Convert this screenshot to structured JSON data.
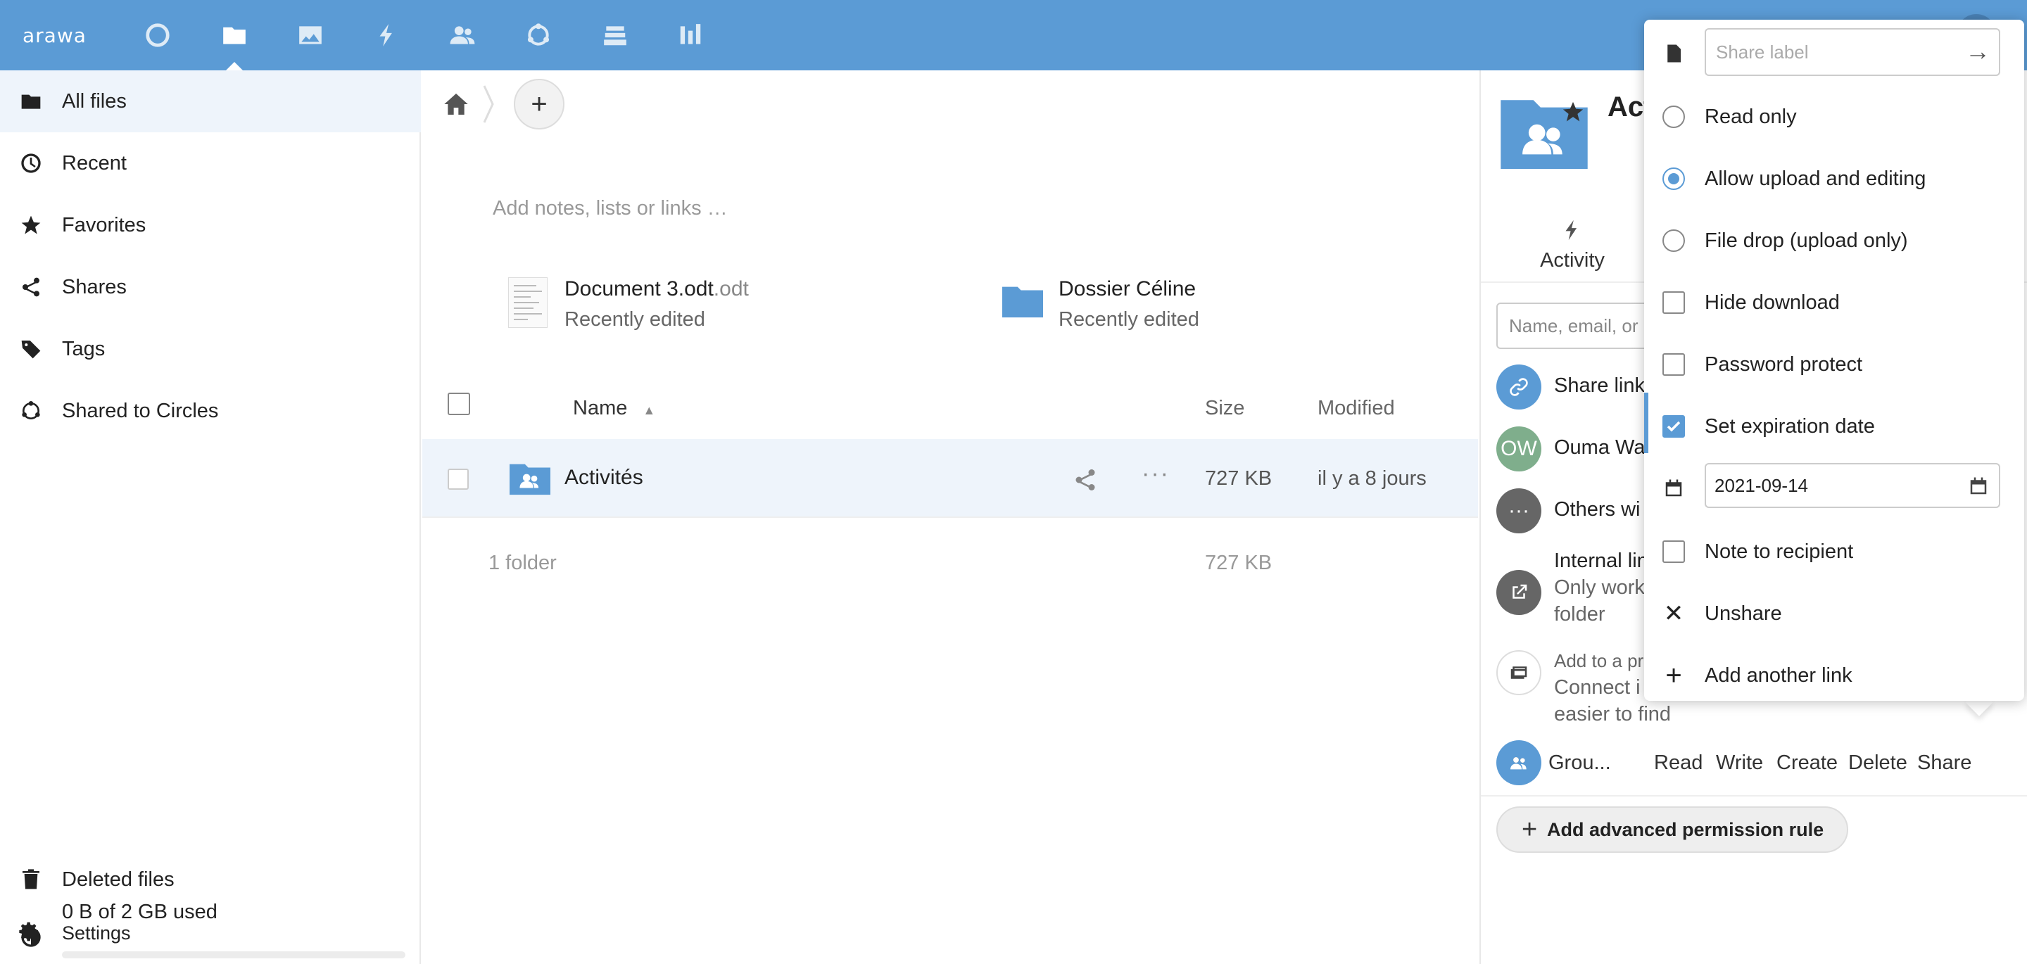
{
  "header": {
    "logo": "arawa",
    "apps": [
      "dashboard-icon",
      "files-icon",
      "photos-icon",
      "activity-icon",
      "contacts-icon",
      "circles-icon",
      "deck-icon",
      "analytics-icon"
    ]
  },
  "nav": {
    "items": [
      {
        "label": "All files",
        "icon": "folder-icon"
      },
      {
        "label": "Recent",
        "icon": "clock-icon"
      },
      {
        "label": "Favorites",
        "icon": "star-icon"
      },
      {
        "label": "Shares",
        "icon": "share-icon"
      },
      {
        "label": "Tags",
        "icon": "tag-icon"
      },
      {
        "label": "Shared to Circles",
        "icon": "circles-icon"
      }
    ],
    "deleted_label": "Deleted files",
    "quota_label": "0 B of 2 GB used",
    "settings_label": "Settings"
  },
  "main": {
    "add_label": "+",
    "notes_placeholder": "Add notes, lists or links …",
    "recent": [
      {
        "name": "Document 3.odt",
        "ext": ".odt",
        "sub": "Recently edited"
      },
      {
        "name": "Dossier Céline",
        "ext": "",
        "sub": "Recently edited"
      }
    ],
    "columns": {
      "name": "Name",
      "size": "Size",
      "modified": "Modified"
    },
    "files": [
      {
        "name": "Activités",
        "size": "727 KB",
        "modified": "il y a 8 jours"
      }
    ],
    "summary": {
      "count": "1 folder",
      "size": "727 KB"
    }
  },
  "sidebar": {
    "title": "Act",
    "tab_label": "Activity",
    "search_placeholder": "Name, email, or",
    "rows": [
      {
        "label": "Share link",
        "initials": "",
        "color": "#5b9bd5"
      },
      {
        "label": "Ouma Wa",
        "initials": "OW",
        "color": "#7fae8c"
      },
      {
        "label": "Others wi",
        "initials": "",
        "color": "#666666"
      }
    ],
    "internal": {
      "title": "Internal lin",
      "line2": "Only work",
      "line3": "folder"
    },
    "project": {
      "title": "Add to a pr",
      "line2": "Connect i",
      "line3": "easier to find"
    },
    "group_name": "Grou...",
    "perms": [
      "Read",
      "Write",
      "Create",
      "Delete",
      "Share"
    ],
    "advanced_button": "Add advanced permission rule"
  },
  "popover": {
    "share_label_placeholder": "Share label",
    "items": {
      "read_only": "Read only",
      "allow_upload": "Allow upload and editing",
      "file_drop": "File drop (upload only)",
      "hide_download": "Hide download",
      "password": "Password protect",
      "expiration": "Set expiration date",
      "expiration_value": "2021-09-14",
      "note": "Note to recipient",
      "unshare": "Unshare",
      "add_link": "Add another link"
    }
  }
}
